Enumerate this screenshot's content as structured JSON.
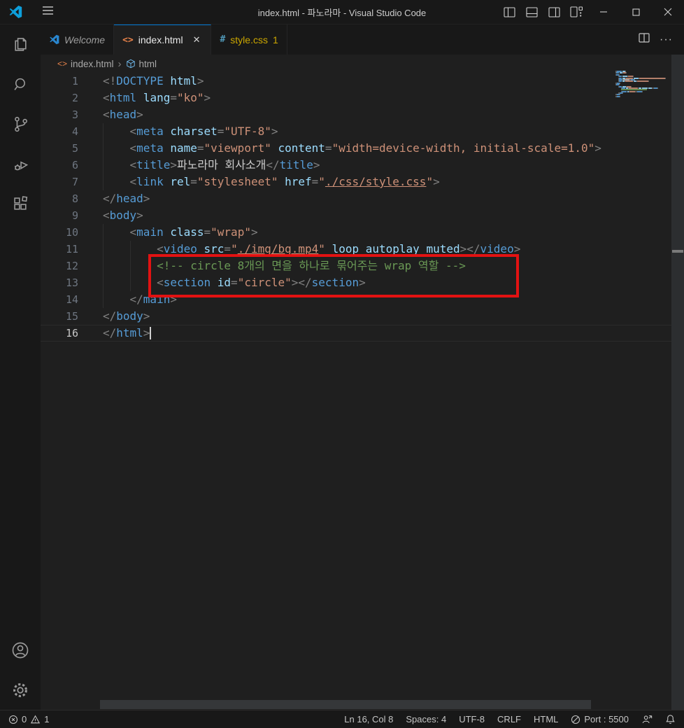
{
  "titlebar": {
    "title": "index.html - 파노라마 - Visual Studio Code"
  },
  "icons": {
    "html_file": "<>",
    "css_file": "#",
    "tab_close": "✕",
    "more_actions": "···",
    "breadcrumb_separator": "›"
  },
  "tabs": [
    {
      "label": "Welcome"
    },
    {
      "label": "index.html",
      "active": true
    },
    {
      "label": "style.css",
      "badge": "1"
    }
  ],
  "breadcrumb": {
    "file": "index.html",
    "symbol": "html"
  },
  "editor": {
    "language": "html",
    "lines": [
      {
        "n": "1",
        "tokens": [
          [
            "p",
            "<!"
          ],
          [
            "t",
            "DOCTYPE"
          ],
          [
            "w",
            " "
          ],
          [
            "a",
            "html"
          ],
          [
            "p",
            ">"
          ]
        ]
      },
      {
        "n": "2",
        "tokens": [
          [
            "p",
            "<"
          ],
          [
            "t",
            "html"
          ],
          [
            "w",
            " "
          ],
          [
            "a",
            "lang"
          ],
          [
            "p",
            "="
          ],
          [
            "s",
            "\"ko\""
          ],
          [
            "p",
            ">"
          ]
        ]
      },
      {
        "n": "3",
        "tokens": [
          [
            "p",
            "<"
          ],
          [
            "t",
            "head"
          ],
          [
            "p",
            ">"
          ]
        ]
      },
      {
        "n": "4",
        "tokens": [
          [
            "w",
            "    "
          ],
          [
            "p",
            "<"
          ],
          [
            "t",
            "meta"
          ],
          [
            "w",
            " "
          ],
          [
            "a",
            "charset"
          ],
          [
            "p",
            "="
          ],
          [
            "s",
            "\"UTF-8\""
          ],
          [
            "p",
            ">"
          ]
        ]
      },
      {
        "n": "5",
        "tokens": [
          [
            "w",
            "    "
          ],
          [
            "p",
            "<"
          ],
          [
            "t",
            "meta"
          ],
          [
            "w",
            " "
          ],
          [
            "a",
            "name"
          ],
          [
            "p",
            "="
          ],
          [
            "s",
            "\"viewport\""
          ],
          [
            "w",
            " "
          ],
          [
            "a",
            "content"
          ],
          [
            "p",
            "="
          ],
          [
            "s",
            "\"width=device-width, initial-scale=1.0\""
          ],
          [
            "p",
            ">"
          ]
        ]
      },
      {
        "n": "6",
        "tokens": [
          [
            "w",
            "    "
          ],
          [
            "p",
            "<"
          ],
          [
            "t",
            "title"
          ],
          [
            "p",
            ">"
          ],
          [
            "x",
            "파노라마 회사소개"
          ],
          [
            "p",
            "</"
          ],
          [
            "t",
            "title"
          ],
          [
            "p",
            ">"
          ]
        ]
      },
      {
        "n": "7",
        "tokens": [
          [
            "w",
            "    "
          ],
          [
            "p",
            "<"
          ],
          [
            "t",
            "link"
          ],
          [
            "w",
            " "
          ],
          [
            "a",
            "rel"
          ],
          [
            "p",
            "="
          ],
          [
            "s",
            "\"stylesheet\""
          ],
          [
            "w",
            " "
          ],
          [
            "a",
            "href"
          ],
          [
            "p",
            "="
          ],
          [
            "s",
            "\""
          ],
          [
            "u",
            "./css/style.css"
          ],
          [
            "s",
            "\""
          ],
          [
            "p",
            ">"
          ]
        ]
      },
      {
        "n": "8",
        "tokens": [
          [
            "p",
            "</"
          ],
          [
            "t",
            "head"
          ],
          [
            "p",
            ">"
          ]
        ]
      },
      {
        "n": "9",
        "tokens": [
          [
            "p",
            "<"
          ],
          [
            "t",
            "body"
          ],
          [
            "p",
            ">"
          ]
        ]
      },
      {
        "n": "10",
        "tokens": [
          [
            "w",
            "    "
          ],
          [
            "p",
            "<"
          ],
          [
            "t",
            "main"
          ],
          [
            "w",
            " "
          ],
          [
            "a",
            "class"
          ],
          [
            "p",
            "="
          ],
          [
            "s",
            "\"wrap\""
          ],
          [
            "p",
            ">"
          ]
        ]
      },
      {
        "n": "11",
        "tokens": [
          [
            "w",
            "        "
          ],
          [
            "p",
            "<"
          ],
          [
            "t",
            "video"
          ],
          [
            "w",
            " "
          ],
          [
            "a",
            "src"
          ],
          [
            "p",
            "="
          ],
          [
            "s",
            "\""
          ],
          [
            "u",
            "./img/bg.mp4"
          ],
          [
            "s",
            "\""
          ],
          [
            "w",
            " "
          ],
          [
            "a",
            "loop"
          ],
          [
            "w",
            " "
          ],
          [
            "a",
            "autoplay"
          ],
          [
            "w",
            " "
          ],
          [
            "a",
            "muted"
          ],
          [
            "p",
            "></"
          ],
          [
            "t",
            "video"
          ],
          [
            "p",
            ">"
          ]
        ]
      },
      {
        "n": "12",
        "tokens": [
          [
            "w",
            "        "
          ],
          [
            "c",
            "<!-- circle 8개의 면을 하나로 묶어주는 wrap 역할 -->"
          ]
        ]
      },
      {
        "n": "13",
        "tokens": [
          [
            "w",
            "        "
          ],
          [
            "p",
            "<"
          ],
          [
            "t",
            "section"
          ],
          [
            "w",
            " "
          ],
          [
            "a",
            "id"
          ],
          [
            "p",
            "="
          ],
          [
            "s",
            "\"circle\""
          ],
          [
            "p",
            "></"
          ],
          [
            "t",
            "section"
          ],
          [
            "p",
            ">"
          ]
        ]
      },
      {
        "n": "14",
        "tokens": [
          [
            "w",
            "    "
          ],
          [
            "p",
            "</"
          ],
          [
            "t",
            "main"
          ],
          [
            "p",
            ">"
          ]
        ]
      },
      {
        "n": "15",
        "tokens": [
          [
            "p",
            "</"
          ],
          [
            "t",
            "body"
          ],
          [
            "p",
            ">"
          ]
        ]
      },
      {
        "n": "16",
        "tokens": [
          [
            "p",
            "</"
          ],
          [
            "t",
            "html"
          ],
          [
            "p",
            ">"
          ]
        ],
        "cursor": true,
        "current": true
      }
    ]
  },
  "annotation": {
    "highlighted_lines": "12-13",
    "color": "#e21212"
  },
  "statusbar": {
    "errors": "0",
    "warnings": "1",
    "line_col": "Ln 16, Col 8",
    "spaces": "Spaces: 4",
    "encoding": "UTF-8",
    "eol": "CRLF",
    "language": "HTML",
    "port": "Port : 5500"
  },
  "colors": {
    "accent": "#0078d4",
    "annotation_red": "#e21212",
    "warning_yellow": "#cca700",
    "tag_blue": "#569cd6",
    "attr_blue": "#9cdcfe",
    "string_orange": "#ce9178",
    "comment_green": "#6a9955",
    "punct_gray": "#808080",
    "titlebar_bg": "#181818",
    "editor_bg": "#1f1f1f"
  }
}
